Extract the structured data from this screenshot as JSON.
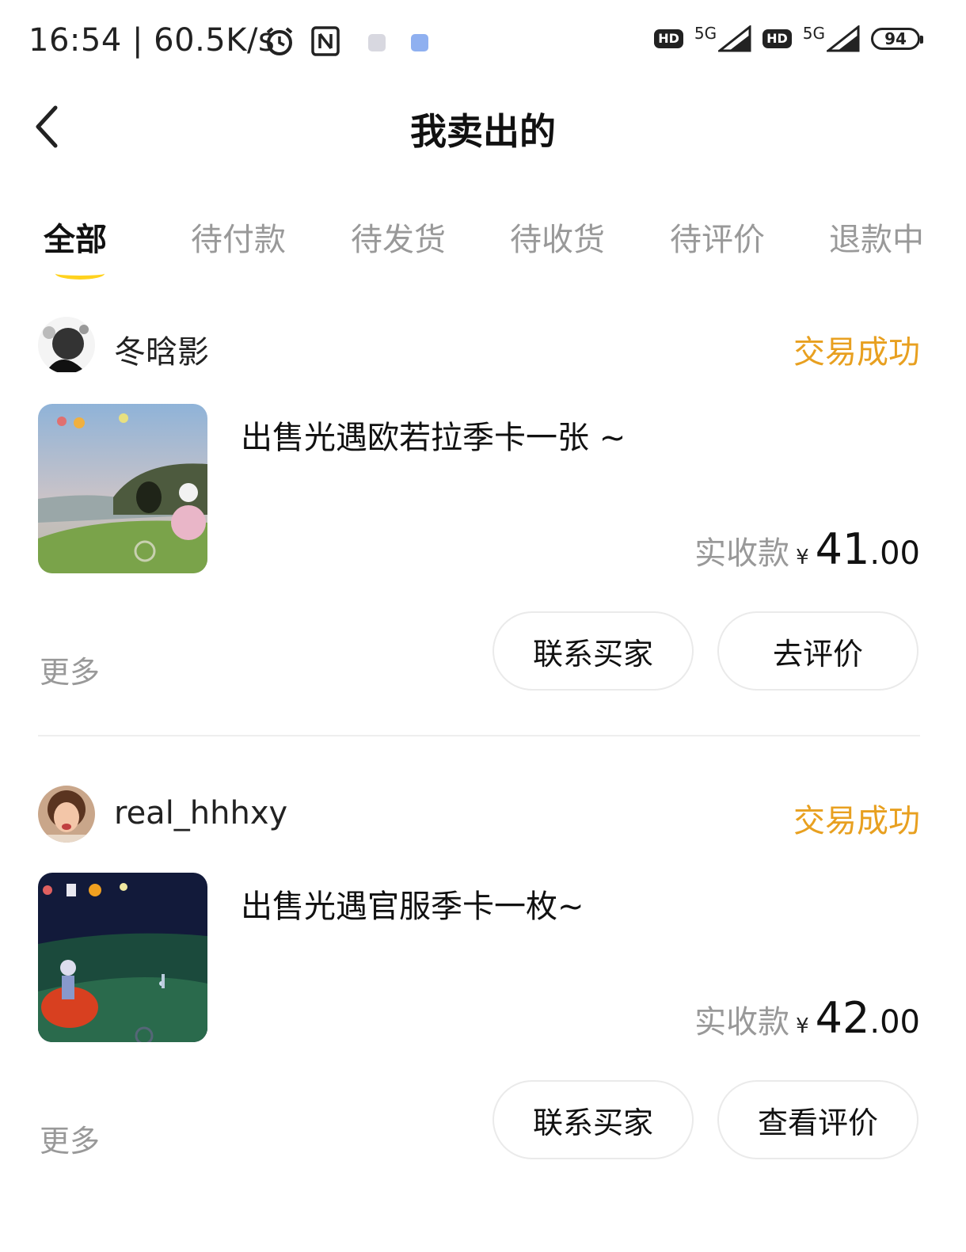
{
  "status_bar": {
    "time": "16:54 | 60.5K/s",
    "sim1": {
      "hd": "HD",
      "net": "5G"
    },
    "sim2": {
      "hd": "HD",
      "net": "5G"
    },
    "battery": "94"
  },
  "header": {
    "title": "我卖出的"
  },
  "tabs": [
    {
      "label": "全部",
      "active": true
    },
    {
      "label": "待付款",
      "active": false
    },
    {
      "label": "待发货",
      "active": false
    },
    {
      "label": "待收货",
      "active": false
    },
    {
      "label": "待评价",
      "active": false
    },
    {
      "label": "退款中",
      "active": false
    }
  ],
  "orders": [
    {
      "buyer": "冬晗影",
      "status": "交易成功",
      "title": "出售光遇欧若拉季卡一张 ~",
      "price_label": "实收款",
      "currency": "¥",
      "price_int": "41",
      "price_dec": ".00",
      "more": "更多",
      "actions": [
        "联系买家",
        "去评价"
      ]
    },
    {
      "buyer": "real_hhhxy",
      "status": "交易成功",
      "title": "出售光遇官服季卡一枚~",
      "price_label": "实收款",
      "currency": "¥",
      "price_int": "42",
      "price_dec": ".00",
      "more": "更多",
      "actions": [
        "联系买家",
        "查看评价"
      ]
    }
  ],
  "colors": {
    "accent_status": "#e8a020",
    "tab_underline": "#ffd21e"
  }
}
